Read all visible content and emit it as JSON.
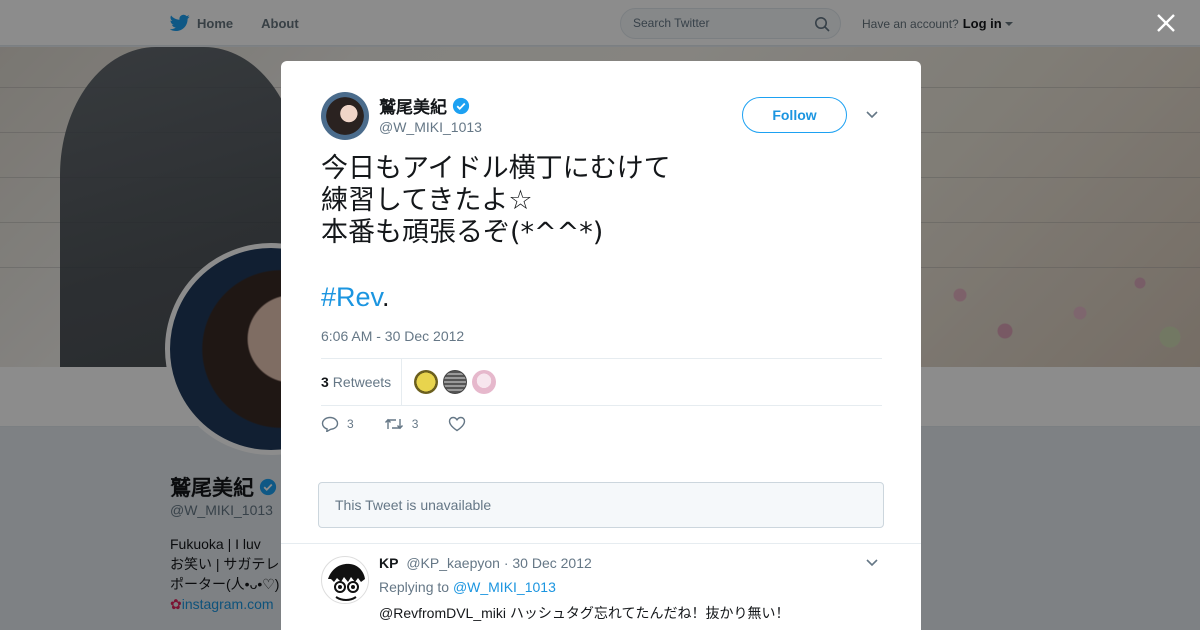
{
  "nav": {
    "home_label": "Home",
    "about_label": "About",
    "search_placeholder": "Search Twitter",
    "have_account": "Have an account?",
    "login_label": "Log in"
  },
  "profile": {
    "name": "鷲尾美紀",
    "handle": "@W_MIKI_1013",
    "bio_lines": [
      "Fukuoka | I luv",
      "お笑い | サガテレ",
      "ポーター(人•ᴗ•♡)"
    ],
    "bio_link": "instagram.com"
  },
  "tweet": {
    "author_name": "鷲尾美紀",
    "author_handle": "@W_MIKI_1013",
    "follow_label": "Follow",
    "text_lines": [
      "今日もアイドル横丁にむけて",
      "練習してきたよ☆",
      "本番も頑張るぞ(*^^*)"
    ],
    "hashtag": "#Rev",
    "hashtag_suffix": ".",
    "timestamp": "6:06 AM - 30 Dec 2012",
    "retweet_count": "3",
    "retweet_label": "Retweets",
    "reply_count": "3",
    "retweet_action_count": "3",
    "unavailable_text": "This Tweet is unavailable"
  },
  "reply": {
    "name": "KP",
    "handle": "@KP_kaepyon",
    "date": "· 30 Dec 2012",
    "replying_to_label": "Replying to",
    "replying_to_handle": "@W_MIKI_1013",
    "text": "@RevfromDVL_miki ハッシュタグ忘れてたんだね！抜かり無い！"
  },
  "colors": {
    "accent": "#1da1f2",
    "link": "#1b95e0",
    "muted": "#657786",
    "verified": "#1da1f2"
  }
}
